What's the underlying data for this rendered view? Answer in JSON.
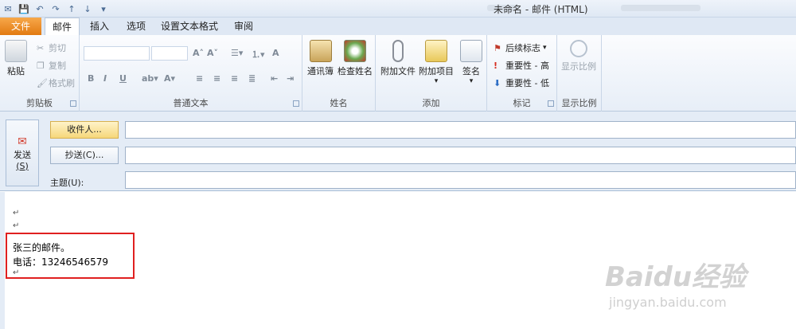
{
  "window": {
    "title": "未命名 - 邮件 (HTML)"
  },
  "tabs": [
    {
      "label": "文件"
    },
    {
      "label": "邮件"
    },
    {
      "label": "插入"
    },
    {
      "label": "选项"
    },
    {
      "label": "设置文本格式"
    },
    {
      "label": "审阅"
    }
  ],
  "ribbon": {
    "clipboard": {
      "label": "剪贴板",
      "paste": "粘贴",
      "cut": "剪切",
      "copy": "复制",
      "format_painter": "格式刷"
    },
    "basic_text": {
      "label": "普通文本"
    },
    "names": {
      "label": "姓名",
      "address_book": "通讯簿",
      "check_names": "检查姓名"
    },
    "include": {
      "label": "添加",
      "attach_file": "附加文件",
      "attach_item": "附加项目",
      "signature": "签名"
    },
    "tags": {
      "label": "标记",
      "follow_up": "后续标志",
      "high_importance": "重要性 - 高",
      "low_importance": "重要性 - 低"
    },
    "zoom": {
      "label": "显示比例",
      "zoom_btn": "显示比例"
    }
  },
  "compose": {
    "send_label": "发送",
    "send_shortcut": "(S)",
    "to_label": "收件人...",
    "cc_label": "抄送(C)...",
    "subject_label": "主题(U):"
  },
  "body": {
    "line1": "张三的邮件。",
    "line2": "电话：13246546579"
  },
  "watermark": {
    "text": "Baidu经验",
    "url": "jingyan.baidu.com"
  }
}
